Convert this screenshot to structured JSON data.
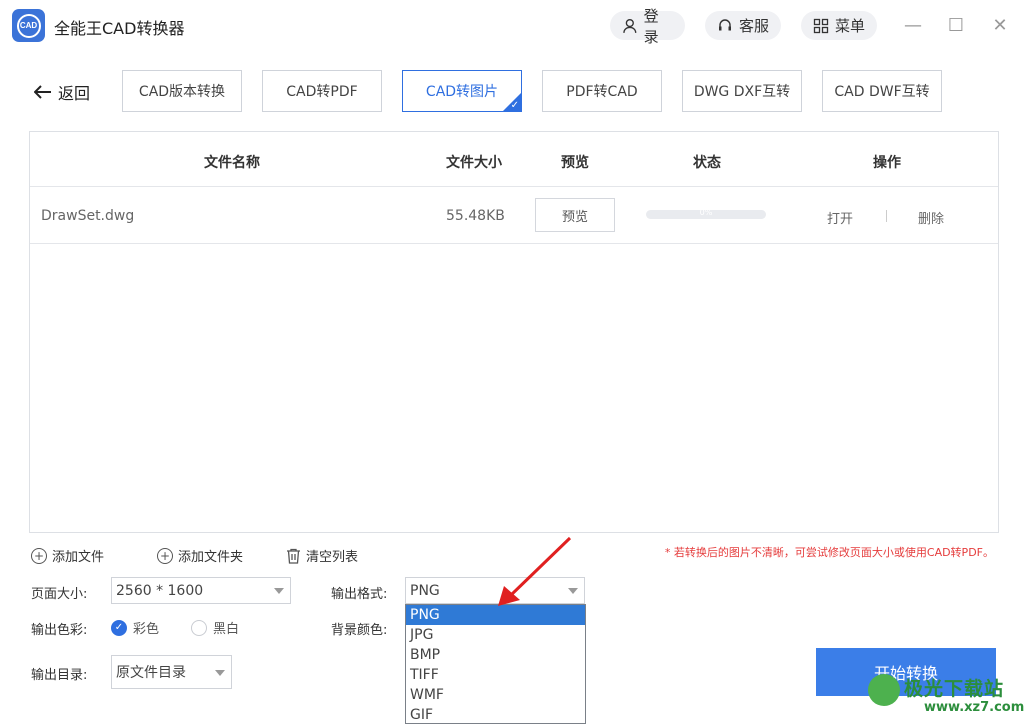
{
  "app": {
    "title": "全能王CAD转换器",
    "logo_text": "CAD"
  },
  "header": {
    "login": "登录",
    "service": "客服",
    "menu": "菜单"
  },
  "window": {
    "minimize": "—",
    "maximize": "☐",
    "close": "✕"
  },
  "toolbar": {
    "back": "返回",
    "tabs": [
      "CAD版本转换",
      "CAD转PDF",
      "CAD转图片",
      "PDF转CAD",
      "DWG DXF互转",
      "CAD DWF互转"
    ],
    "active_index": 2
  },
  "table": {
    "headers": {
      "name": "文件名称",
      "size": "文件大小",
      "preview": "预览",
      "status": "状态",
      "action": "操作"
    },
    "rows": [
      {
        "name": "DrawSet.dwg",
        "size": "55.48KB",
        "preview": "预览",
        "progress": 0,
        "progress_text": "0%",
        "open": "打开",
        "delete": "删除"
      }
    ]
  },
  "actions": {
    "add_file": "添加文件",
    "add_folder": "添加文件夹",
    "clear": "清空列表"
  },
  "notice": "* 若转换后的图片不清晰，可尝试修改页面大小或使用CAD转PDF。",
  "settings": {
    "page_size_label": "页面大小:",
    "page_size_value": "2560 * 1600",
    "format_label": "输出格式:",
    "format_value": "PNG",
    "color_label": "输出色彩:",
    "color_option": "彩色",
    "bw_option": "黑白",
    "bg_label": "背景颜色:",
    "dir_label": "输出目录:",
    "dir_value": "原文件目录"
  },
  "format_options": [
    "PNG",
    "JPG",
    "BMP",
    "TIFF",
    "WMF",
    "GIF"
  ],
  "start_button": "开始转换",
  "watermark": {
    "text": "极光下载站",
    "url": "www.xz7.com"
  },
  "colors": {
    "accent": "#2f6fe0",
    "notice": "#e53c3c",
    "arrow": "#e02020"
  }
}
